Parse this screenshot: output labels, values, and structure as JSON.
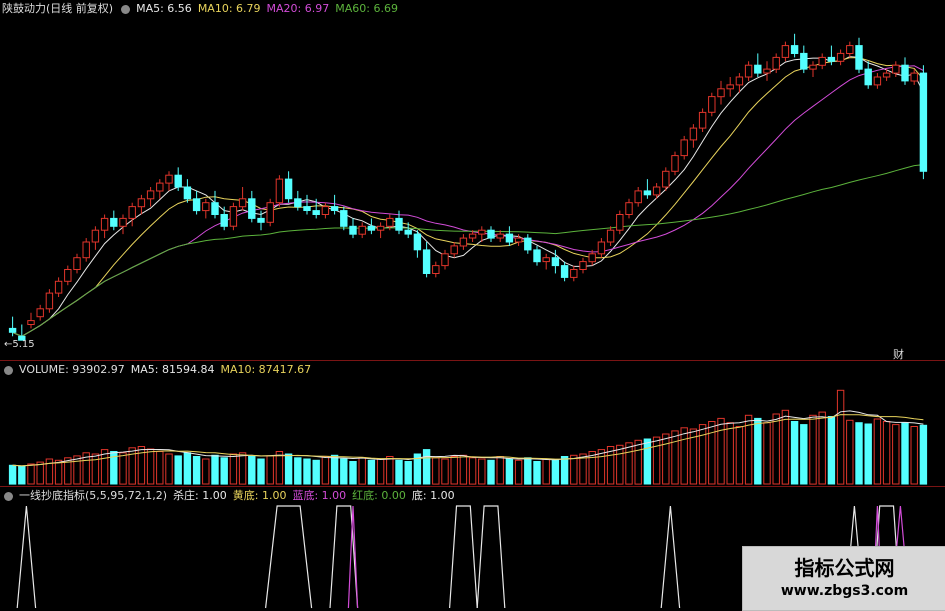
{
  "colors": {
    "up": "#e0352b",
    "down": "#54ffff",
    "ma5": "#e8e8e8",
    "ma10": "#e8d35c",
    "ma20": "#d24cd8",
    "ma60": "#5cb33c",
    "divider": "#7a1414",
    "yellow": "#e8d35c",
    "magenta": "#d24cd8",
    "green": "#5cb33c",
    "white": "#dddddd"
  },
  "price_panel": {
    "title": "陕鼓动力(日线 前复权)",
    "ma5_label": "MA5: 6.56",
    "ma10_label": "MA10: 6.79",
    "ma20_label": "MA20: 6.97",
    "ma60_label": "MA60: 6.69",
    "low_marker": "←5.15",
    "corner_glyph": "财"
  },
  "volume_panel": {
    "title": "VOLUME: 93902.97",
    "ma5_label": "MA5: 81594.84",
    "ma10_label": "MA10: 87417.67"
  },
  "indicator_panel": {
    "title": "一线抄底指标(5,5,95,72,1,2)",
    "items": [
      {
        "label": "杀庄: 1.00",
        "color": "#e8e8e8"
      },
      {
        "label": "黄底: 1.00",
        "color": "#e8d35c"
      },
      {
        "label": "蓝底: 1.00",
        "color": "#d24cd8"
      },
      {
        "label": "红底: 0.00",
        "color": "#5cb33c"
      },
      {
        "label": "底: 1.00",
        "color": "#e8e8e8"
      }
    ]
  },
  "watermark": {
    "title": "指标公式网",
    "url": "www.zbgs3.com"
  },
  "chart_data": [
    {
      "type": "candlestick",
      "title": "陕鼓动力(日线 前复权)",
      "series_names": [
        "MA5",
        "MA10",
        "MA20",
        "MA60"
      ],
      "last_values": {
        "MA5": 6.56,
        "MA10": 6.79,
        "MA20": 6.97,
        "MA60": 6.69
      },
      "annotations": [
        "←5.15"
      ],
      "ohlc": [
        [
          5.3,
          5.45,
          5.25,
          5.2
        ],
        [
          5.2,
          5.35,
          5.15,
          5.15
        ],
        [
          5.35,
          5.5,
          5.4,
          5.3
        ],
        [
          5.45,
          5.6,
          5.55,
          5.4
        ],
        [
          5.55,
          5.8,
          5.75,
          5.5
        ],
        [
          5.75,
          5.95,
          5.9,
          5.7
        ],
        [
          5.9,
          6.1,
          6.05,
          5.85
        ],
        [
          6.05,
          6.25,
          6.2,
          6.0
        ],
        [
          6.2,
          6.45,
          6.4,
          6.15
        ],
        [
          6.4,
          6.6,
          6.55,
          6.3
        ],
        [
          6.55,
          6.75,
          6.7,
          6.45
        ],
        [
          6.7,
          6.8,
          6.6,
          6.55
        ],
        [
          6.6,
          6.75,
          6.7,
          6.5
        ],
        [
          6.7,
          6.9,
          6.85,
          6.6
        ],
        [
          6.85,
          7.0,
          6.95,
          6.75
        ],
        [
          6.95,
          7.1,
          7.05,
          6.85
        ],
        [
          7.05,
          7.2,
          7.15,
          6.95
        ],
        [
          7.15,
          7.3,
          7.25,
          7.05
        ],
        [
          7.25,
          7.35,
          7.1,
          7.05
        ],
        [
          7.1,
          7.2,
          6.95,
          6.9
        ],
        [
          6.95,
          7.05,
          6.8,
          6.75
        ],
        [
          6.8,
          6.95,
          6.9,
          6.7
        ],
        [
          6.9,
          7.05,
          6.75,
          6.7
        ],
        [
          6.75,
          6.85,
          6.6,
          6.55
        ],
        [
          6.6,
          6.9,
          6.85,
          6.55
        ],
        [
          6.85,
          7.1,
          6.95,
          6.8
        ],
        [
          6.95,
          7.05,
          6.7,
          6.65
        ],
        [
          6.7,
          6.8,
          6.65,
          6.55
        ],
        [
          6.65,
          6.95,
          6.9,
          6.6
        ],
        [
          6.9,
          7.25,
          7.2,
          6.85
        ],
        [
          7.2,
          7.3,
          6.95,
          6.9
        ],
        [
          6.95,
          7.05,
          6.85,
          6.8
        ],
        [
          6.85,
          7.0,
          6.8,
          6.75
        ],
        [
          6.8,
          6.95,
          6.75,
          6.7
        ],
        [
          6.75,
          6.9,
          6.85,
          6.7
        ],
        [
          6.85,
          7.0,
          6.8,
          6.75
        ],
        [
          6.8,
          6.85,
          6.6,
          6.55
        ],
        [
          6.6,
          6.7,
          6.5,
          6.45
        ],
        [
          6.5,
          6.65,
          6.6,
          6.45
        ],
        [
          6.6,
          6.7,
          6.55,
          6.5
        ],
        [
          6.55,
          6.65,
          6.6,
          6.45
        ],
        [
          6.6,
          6.75,
          6.7,
          6.55
        ],
        [
          6.7,
          6.8,
          6.55,
          6.5
        ],
        [
          6.55,
          6.65,
          6.5,
          6.45
        ],
        [
          6.5,
          6.55,
          6.3,
          6.2
        ],
        [
          6.3,
          6.4,
          6.0,
          5.95
        ],
        [
          6.0,
          6.15,
          6.1,
          5.95
        ],
        [
          6.1,
          6.3,
          6.25,
          6.05
        ],
        [
          6.25,
          6.4,
          6.35,
          6.2
        ],
        [
          6.35,
          6.5,
          6.45,
          6.3
        ],
        [
          6.45,
          6.55,
          6.5,
          6.4
        ],
        [
          6.5,
          6.6,
          6.55,
          6.4
        ],
        [
          6.55,
          6.6,
          6.45,
          6.4
        ],
        [
          6.45,
          6.55,
          6.5,
          6.4
        ],
        [
          6.5,
          6.6,
          6.4,
          6.35
        ],
        [
          6.4,
          6.5,
          6.45,
          6.35
        ],
        [
          6.45,
          6.5,
          6.3,
          6.25
        ],
        [
          6.3,
          6.35,
          6.15,
          6.1
        ],
        [
          6.15,
          6.25,
          6.2,
          6.05
        ],
        [
          6.2,
          6.3,
          6.1,
          6.0
        ],
        [
          6.1,
          6.15,
          5.95,
          5.9
        ],
        [
          5.95,
          6.1,
          6.05,
          5.9
        ],
        [
          6.05,
          6.2,
          6.15,
          6.0
        ],
        [
          6.15,
          6.3,
          6.25,
          6.1
        ],
        [
          6.25,
          6.45,
          6.4,
          6.2
        ],
        [
          6.4,
          6.6,
          6.55,
          6.35
        ],
        [
          6.55,
          6.8,
          6.75,
          6.5
        ],
        [
          6.75,
          6.95,
          6.9,
          6.7
        ],
        [
          6.9,
          7.1,
          7.05,
          6.85
        ],
        [
          7.05,
          7.2,
          7.0,
          6.95
        ],
        [
          7.0,
          7.15,
          7.1,
          6.95
        ],
        [
          7.1,
          7.35,
          7.3,
          7.05
        ],
        [
          7.3,
          7.55,
          7.5,
          7.25
        ],
        [
          7.5,
          7.75,
          7.7,
          7.45
        ],
        [
          7.7,
          7.9,
          7.85,
          7.6
        ],
        [
          7.85,
          8.1,
          8.05,
          7.8
        ],
        [
          8.05,
          8.3,
          8.25,
          8.0
        ],
        [
          8.25,
          8.45,
          8.35,
          8.15
        ],
        [
          8.35,
          8.5,
          8.4,
          8.25
        ],
        [
          8.4,
          8.55,
          8.5,
          8.3
        ],
        [
          8.5,
          8.7,
          8.65,
          8.45
        ],
        [
          8.65,
          8.8,
          8.55,
          8.5
        ],
        [
          8.55,
          8.7,
          8.6,
          8.45
        ],
        [
          8.6,
          8.8,
          8.75,
          8.55
        ],
        [
          8.75,
          8.95,
          8.9,
          8.7
        ],
        [
          8.9,
          9.05,
          8.8,
          8.75
        ],
        [
          8.8,
          8.9,
          8.6,
          8.55
        ],
        [
          8.6,
          8.7,
          8.65,
          8.5
        ],
        [
          8.65,
          8.8,
          8.75,
          8.6
        ],
        [
          8.75,
          8.9,
          8.7,
          8.65
        ],
        [
          8.7,
          8.85,
          8.8,
          8.65
        ],
        [
          8.8,
          8.95,
          8.9,
          8.75
        ],
        [
          8.9,
          9.0,
          8.6,
          8.55
        ],
        [
          8.6,
          8.7,
          8.4,
          8.35
        ],
        [
          8.4,
          8.55,
          8.5,
          8.35
        ],
        [
          8.5,
          8.6,
          8.55,
          8.45
        ],
        [
          8.55,
          8.7,
          8.65,
          8.5
        ],
        [
          8.65,
          8.75,
          8.45,
          8.4
        ],
        [
          8.45,
          8.6,
          8.55,
          8.4
        ],
        [
          8.55,
          8.65,
          7.3,
          7.2
        ]
      ]
    },
    {
      "type": "bar",
      "title": "VOLUME: 93902.97",
      "series_names": [
        "MA5",
        "MA10"
      ],
      "last_values": {
        "VOLUME": 93902.97,
        "MA5": 81594.84,
        "MA10": 87417.67
      },
      "values": [
        30,
        28,
        32,
        35,
        40,
        38,
        42,
        45,
        50,
        48,
        55,
        52,
        50,
        58,
        60,
        56,
        52,
        48,
        45,
        50,
        44,
        40,
        46,
        42,
        48,
        50,
        44,
        40,
        45,
        52,
        48,
        42,
        40,
        38,
        44,
        46,
        40,
        36,
        42,
        38,
        40,
        44,
        38,
        36,
        48,
        55,
        42,
        40,
        44,
        46,
        42,
        40,
        38,
        44,
        40,
        38,
        42,
        36,
        40,
        38,
        44,
        46,
        48,
        52,
        55,
        60,
        62,
        66,
        70,
        72,
        75,
        80,
        85,
        90,
        88,
        95,
        100,
        105,
        98,
        92,
        110,
        105,
        98,
        112,
        118,
        100,
        95,
        110,
        115,
        108,
        150,
        102,
        98,
        96,
        104,
        100,
        95,
        98,
        92,
        94
      ]
    },
    {
      "type": "line",
      "title": "一线抄底指标(5,5,95,72,1,2)",
      "series_names": [
        "杀庄",
        "黄底",
        "蓝底",
        "红底",
        "底"
      ],
      "last_values": {
        "杀庄": 1.0,
        "黄底": 1.0,
        "蓝底": 1.0,
        "红底": 0.0,
        "底": 1.0
      },
      "signals_white": [
        [
          1,
          3,
          "tri"
        ],
        [
          28,
          33,
          "trap"
        ],
        [
          35,
          38,
          "trap"
        ],
        [
          48,
          51,
          "trap"
        ],
        [
          51,
          54,
          "trap"
        ],
        [
          71,
          73,
          "tri"
        ],
        [
          91,
          93,
          "tri"
        ],
        [
          94,
          97,
          "trap"
        ]
      ],
      "signals_magenta": [
        [
          37,
          38,
          "tri"
        ],
        [
          94,
          95,
          "tri"
        ],
        [
          96,
          98,
          "tri"
        ]
      ]
    }
  ]
}
